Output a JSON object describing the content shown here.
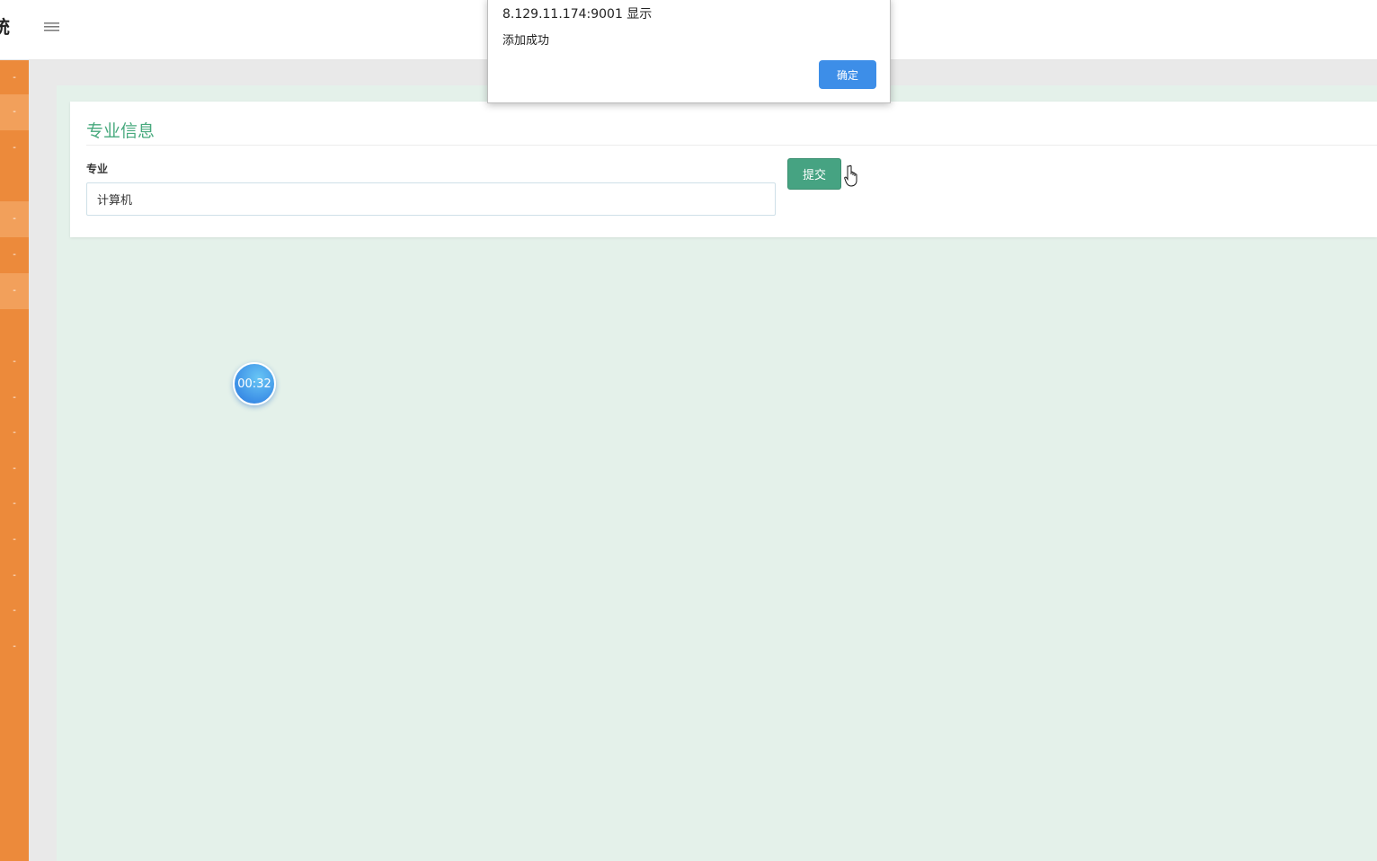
{
  "header": {
    "title_fragment": "统",
    "menu_icon": "hamburger-menu-icon"
  },
  "sidebar": {
    "items": [
      {
        "glyph": "-",
        "highlight": false
      },
      {
        "glyph": "-",
        "highlight": true
      },
      {
        "glyph": "-",
        "highlight": false
      },
      {
        "glyph": "-",
        "highlight": true
      },
      {
        "glyph": "-",
        "highlight": false
      },
      {
        "glyph": "-",
        "highlight": true
      },
      {
        "glyph": "-",
        "highlight": false
      },
      {
        "glyph": "-",
        "highlight": false
      },
      {
        "glyph": "-",
        "highlight": false
      },
      {
        "glyph": "-",
        "highlight": false
      },
      {
        "glyph": "-",
        "highlight": false
      },
      {
        "glyph": "-",
        "highlight": false
      },
      {
        "glyph": "-",
        "highlight": false
      },
      {
        "glyph": "-",
        "highlight": false
      },
      {
        "glyph": "-",
        "highlight": false
      }
    ]
  },
  "form": {
    "title": "专业信息",
    "field_label": "专业",
    "field_value": "计算机",
    "submit_label": "提交"
  },
  "timer": {
    "text": "00:32"
  },
  "dialog": {
    "title": "8.129.11.174:9001 显示",
    "message": "添加成功",
    "ok_label": "确定"
  },
  "colors": {
    "sidebar": "#ec8a3b",
    "accent_green": "#47a97d",
    "dialog_button": "#3d8ee8",
    "content_bg": "#e4f1ea"
  }
}
